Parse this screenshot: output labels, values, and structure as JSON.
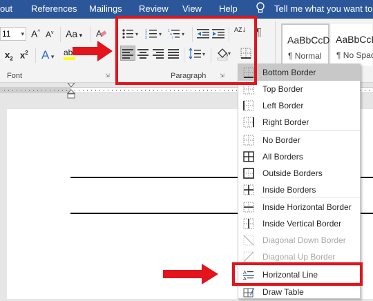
{
  "menu": {
    "items": [
      "out",
      "References",
      "Mailings",
      "Review",
      "View",
      "Help"
    ],
    "tell_me": "Tell me what you want to d"
  },
  "ribbon": {
    "font_size": "11",
    "font_group_label": "Font",
    "paragraph_group_label": "Paragraph",
    "grow_font": "A",
    "shrink_font": "A",
    "change_case": "Aa",
    "subscript": "x",
    "superscript": "x",
    "text_effects": "A",
    "highlight": "ab",
    "sort": "AZ",
    "styles": [
      {
        "sample": "AaBbCcDc",
        "name": "¶ Normal"
      },
      {
        "sample": "AaBbCcDc",
        "name": "¶ No Spac..."
      }
    ]
  },
  "border_menu": {
    "items": [
      {
        "label": "Bottom Border",
        "icon": "bottom-border-icon",
        "highlighted": true,
        "disabled": false
      },
      {
        "label": "Top Border",
        "icon": "top-border-icon",
        "highlighted": false,
        "disabled": false
      },
      {
        "label": "Left Border",
        "icon": "left-border-icon",
        "highlighted": false,
        "disabled": false
      },
      {
        "label": "Right Border",
        "icon": "right-border-icon",
        "highlighted": false,
        "disabled": false
      },
      {
        "label": "No Border",
        "icon": "no-border-icon",
        "highlighted": false,
        "disabled": false
      },
      {
        "label": "All Borders",
        "icon": "all-borders-icon",
        "highlighted": false,
        "disabled": false
      },
      {
        "label": "Outside Borders",
        "icon": "outside-borders-icon",
        "highlighted": false,
        "disabled": false
      },
      {
        "label": "Inside Borders",
        "icon": "inside-borders-icon",
        "highlighted": false,
        "disabled": false
      },
      {
        "label": "Inside Horizontal Border",
        "icon": "inside-horizontal-border-icon",
        "highlighted": false,
        "disabled": false
      },
      {
        "label": "Inside Vertical Border",
        "icon": "inside-vertical-border-icon",
        "highlighted": false,
        "disabled": false
      },
      {
        "label": "Diagonal Down Border",
        "icon": "diagonal-down-border-icon",
        "highlighted": false,
        "disabled": true
      },
      {
        "label": "Diagonal Up Border",
        "icon": "diagonal-up-border-icon",
        "highlighted": false,
        "disabled": true
      },
      {
        "label": "Horizontal Line",
        "icon": "horizontal-line-icon",
        "highlighted": false,
        "disabled": false
      },
      {
        "label": "Draw Table",
        "icon": "draw-table-icon",
        "highlighted": false,
        "disabled": false
      }
    ]
  },
  "colors": {
    "title_bar": "#2b579a",
    "annotation_red": "#e3141b",
    "menu_highlight": "#c8c8c8",
    "disabled_text": "#a8a8a8"
  }
}
